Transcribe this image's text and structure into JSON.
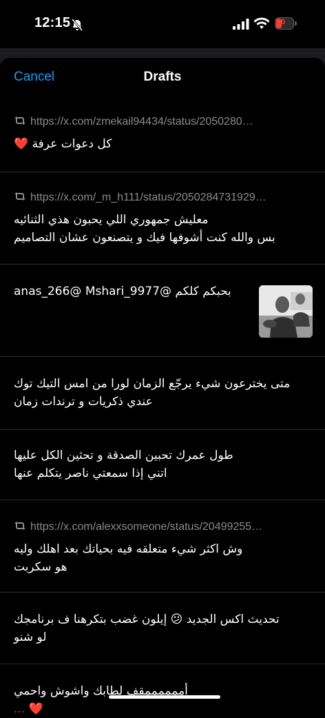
{
  "status_bar": {
    "time": "12:15",
    "battery_text": "10"
  },
  "header": {
    "cancel_label": "Cancel",
    "title": "Drafts"
  },
  "drafts": [
    {
      "url": "https://x.com/zmekail94434/status/2050280…",
      "text": "كل دعوات عرفة ❤️"
    },
    {
      "url": "https://x.com/_m_h111/status/2050284731929…",
      "lines": [
        "معليش جمهوري اللي يحبون هذي الثنائيه",
        "بس والله كنت أشوفها فيك و يتصنعون عشان التصاميم"
      ]
    },
    {
      "text": "بحبكم كلكم @anas_266@ Mshari_9977",
      "has_image": true
    },
    {
      "lines": [
        "متى يخترعون شيء يرجّع الزمان لورا من امس التيك توك",
        "عندي ذكريات و ترندات زمان"
      ]
    },
    {
      "lines": [
        "طول عمرك تحبين الصدقة و تحثين الكل عليها",
        "اتني إذا سمعتي ناصر يتكلم عنها"
      ]
    },
    {
      "url": "https://x.com/alexxsomeone/status/20499255…",
      "lines": [
        "وش اكثر شيء متعلقه فيه بحياتك بعد اهلك وليه",
        "هو سكربت"
      ]
    },
    {
      "lines": [
        "تحديث اكس الجديد 😕 إيلون غضب بتكرهنا ف برنامجك",
        "لو شنو"
      ]
    },
    {
      "lines": [
        "أممممممقف لطابك واشوش واحمي",
        "❤️ ..."
      ]
    }
  ],
  "colors": {
    "accent": "#1d9bf0",
    "muted": "#8b8b90",
    "heart": "#e0245e",
    "background": "#000000"
  },
  "icons": {
    "retweet": "retweet-icon",
    "bell": "bell-slash-icon"
  }
}
